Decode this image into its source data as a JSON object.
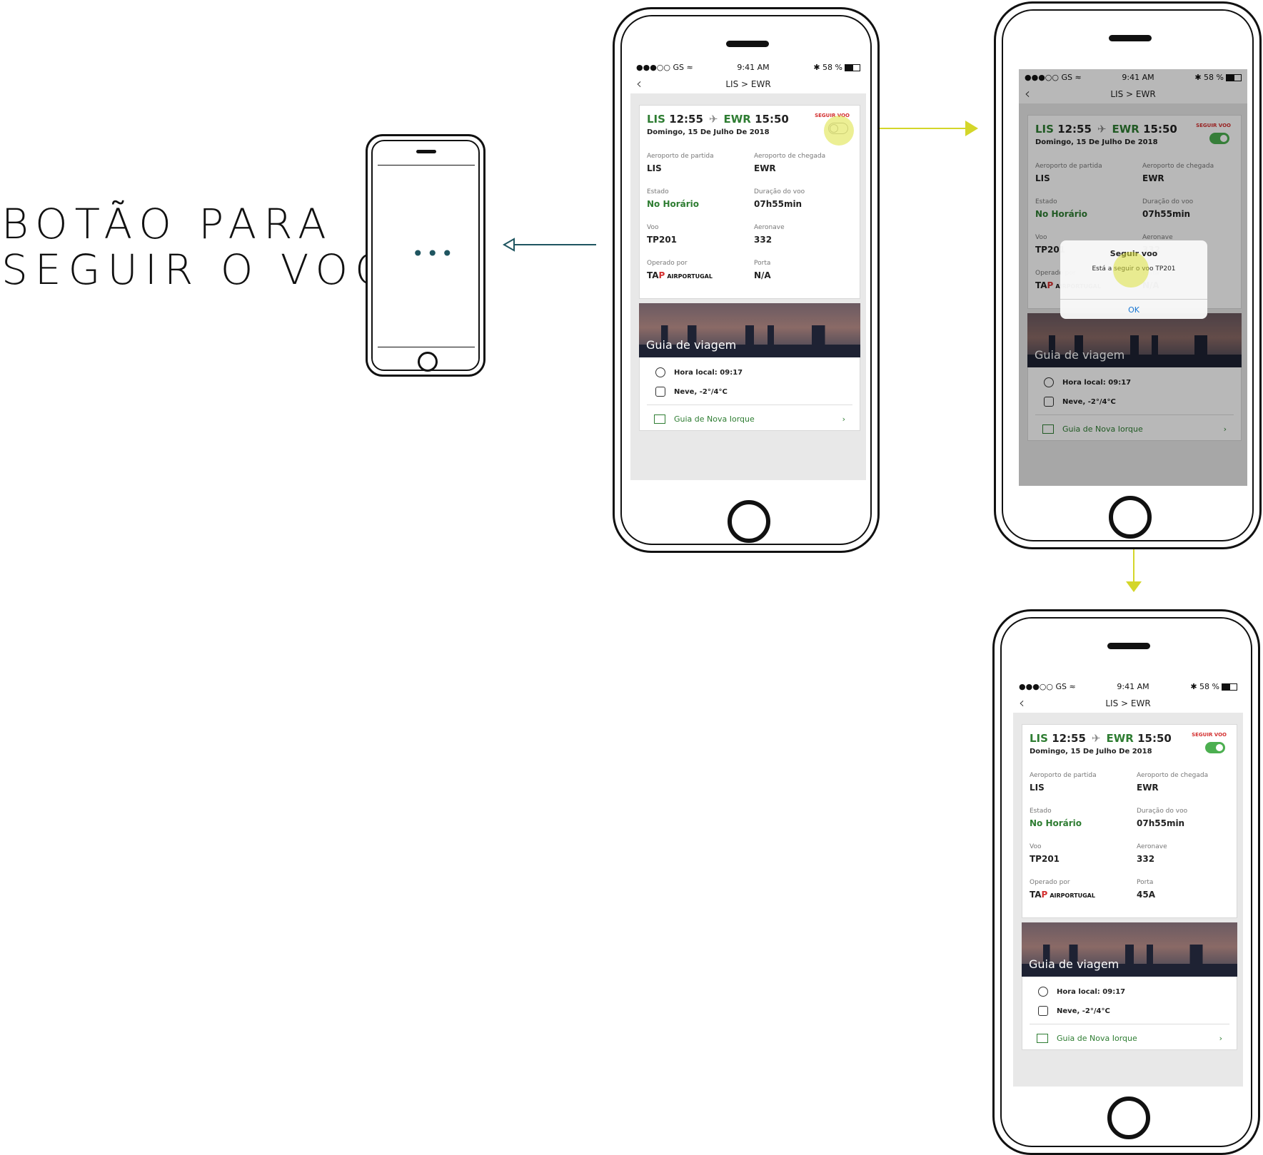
{
  "title": {
    "line1": "BOTÃO PARA",
    "line2": "SEGUIR O VOO"
  },
  "colors": {
    "accent_green": "#2e7d32",
    "toggle_green": "#4caf50",
    "seguir_red": "#d32f2f",
    "arrow_yellow": "#d4d62a",
    "arrow_teal": "#1f5560"
  },
  "loading_phone": {
    "indicator": "•••"
  },
  "status_bar": {
    "carrier": "●●●○○ GS ≈",
    "time": "9:41 AM",
    "battery": "✱ 58 %"
  },
  "nav": {
    "back": "‹",
    "title": "LIS > EWR"
  },
  "flight": {
    "dep_code": "LIS",
    "dep_time": "12:55",
    "plane_icon": "✈",
    "arr_code": "EWR",
    "arr_time": "15:50",
    "date": "Domingo, 15 De Julho De 2018",
    "seguir_label": "SEGUIR VOO",
    "dep_airport_label": "Aeroporto de partida",
    "dep_airport": "LIS",
    "arr_airport_label": "Aeroporto de chegada",
    "arr_airport": "EWR",
    "status_label": "Estado",
    "status": "No Horário",
    "duration_label": "Duração do voo",
    "duration": "07h55min",
    "flight_label": "Voo",
    "flight_no": "TP201",
    "aircraft_label": "Aeronave",
    "aircraft": "332",
    "operated_label": "Operado por",
    "operator_t": "TA",
    "operator_p": "P",
    "operator_name": "AIRPORTUGAL",
    "gate_label": "Porta",
    "gate_na": "N/A",
    "gate_final": "45A"
  },
  "guide": {
    "title": "Guia de viagem",
    "local_time": "Hora local: 09:17",
    "weather": "Neve, -2°/4°C",
    "link": "Guia de Nova Iorque",
    "chevron": "›"
  },
  "dialog": {
    "title": "Seguir voo",
    "message": "Está a seguir o voo TP201",
    "ok": "OK"
  }
}
